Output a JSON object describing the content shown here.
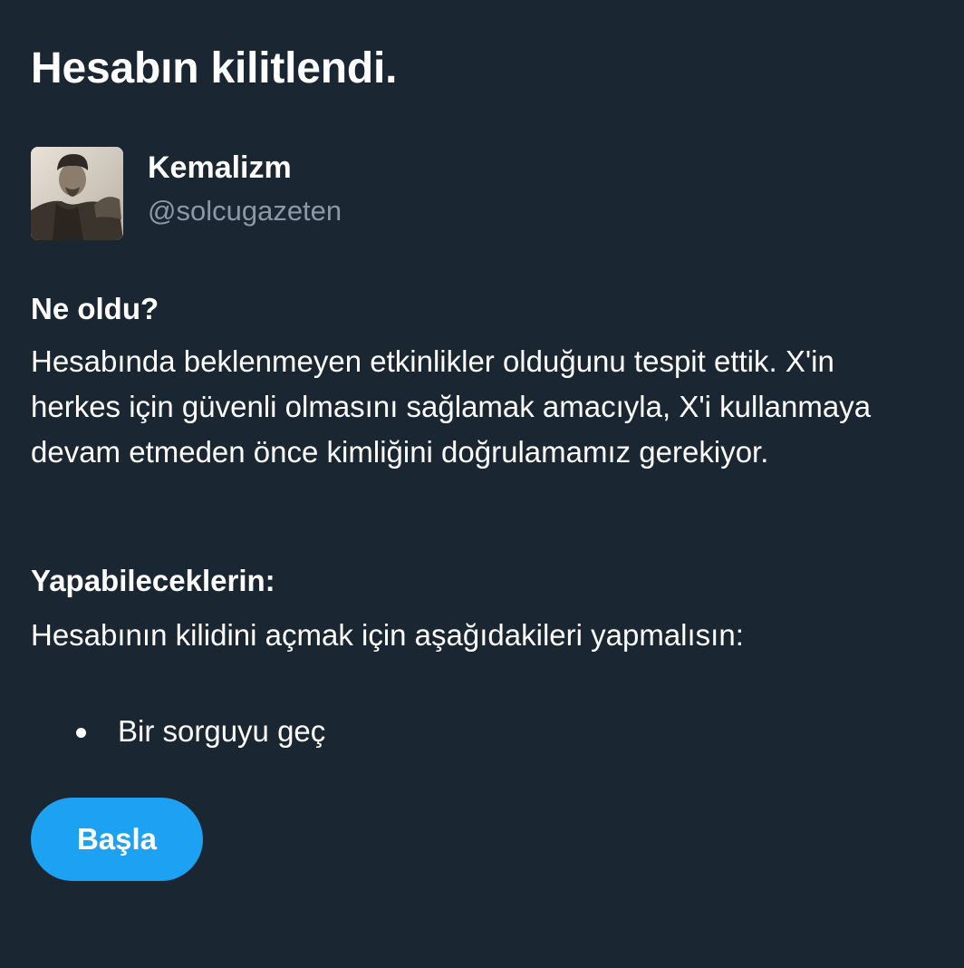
{
  "dialog": {
    "title": "Hesabın kilitlendi."
  },
  "account": {
    "name": "Kemalizm",
    "handle": "@solcugazeten"
  },
  "what_happened": {
    "heading": "Ne oldu?",
    "body": "Hesabında beklenmeyen etkinlikler olduğunu tespit ettik. X'in herkes için güvenli olmasını sağlamak amacıyla, X'i kullanmaya devam etmeden önce kimliğini doğrulamamız gerekiyor."
  },
  "what_you_can_do": {
    "heading": "Yapabileceklerin:",
    "body": "Hesabının kilidini açmak için aşağıdakileri yapmalısın:",
    "steps": [
      "Bir sorguyu geç"
    ]
  },
  "actions": {
    "start_label": "Başla"
  },
  "colors": {
    "background": "#1b2633",
    "text_primary": "#ffffff",
    "text_secondary": "#8b98a6",
    "accent": "#1da1f2"
  }
}
